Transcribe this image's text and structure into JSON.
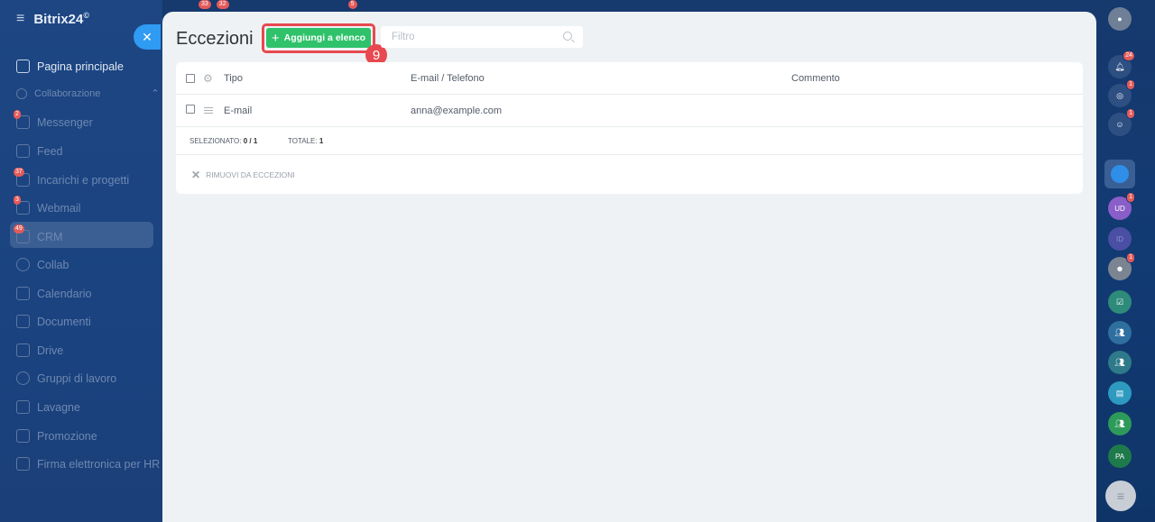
{
  "sidebar": {
    "logo": "Bitrix24",
    "logo_sup": "©",
    "items": [
      {
        "label": "Pagina principale",
        "icon": "home-icon"
      },
      {
        "label": "Collaborazione",
        "icon": "collab-section-icon"
      },
      {
        "label": "Messenger",
        "icon": "messenger-icon",
        "badge": "2"
      },
      {
        "label": "Feed",
        "icon": "feed-icon"
      },
      {
        "label": "Incarichi e progetti",
        "icon": "tasks-icon",
        "badge": "37"
      },
      {
        "label": "Webmail",
        "icon": "mail-icon",
        "badge": "3"
      },
      {
        "label": "CRM",
        "icon": "crm-icon",
        "badge": "49"
      },
      {
        "label": "Collab",
        "icon": "collab-icon"
      },
      {
        "label": "Calendario",
        "icon": "calendar-icon"
      },
      {
        "label": "Documenti",
        "icon": "documents-icon"
      },
      {
        "label": "Drive",
        "icon": "drive-icon"
      },
      {
        "label": "Gruppi di lavoro",
        "icon": "groups-icon"
      },
      {
        "label": "Lavagne",
        "icon": "boards-icon"
      },
      {
        "label": "Promozione",
        "icon": "promo-icon"
      },
      {
        "label": "Firma elettronica per HR",
        "icon": "esign-icon"
      }
    ]
  },
  "top_badges": [
    "33",
    "32",
    "5"
  ],
  "panel": {
    "title": "Eccezioni",
    "add_button": "Aggiungi a elenco",
    "step_number": "9",
    "filter_placeholder": "Filtro"
  },
  "grid": {
    "columns": [
      "Tipo",
      "E-mail / Telefono",
      "Commento"
    ],
    "rows": [
      {
        "type": "E-mail",
        "contact": "anna@example.com",
        "comment": ""
      }
    ],
    "footer": {
      "selected_label": "SELEZIONATO:",
      "selected_value": "0 / 1",
      "total_label": "TOTALE:",
      "total_value": "1"
    },
    "remove_action": "RIMUOVI DA ECCEZIONI"
  },
  "rail": {
    "badges": {
      "notifications": "24",
      "activity": "1",
      "chat": "1",
      "ud": "1",
      "user": "1"
    },
    "avatars": [
      "UD",
      "ID",
      "PA"
    ]
  },
  "colors": {
    "accent_green": "#2fc26b",
    "highlight_red": "#e84850",
    "close_blue": "#2f9bf3"
  }
}
